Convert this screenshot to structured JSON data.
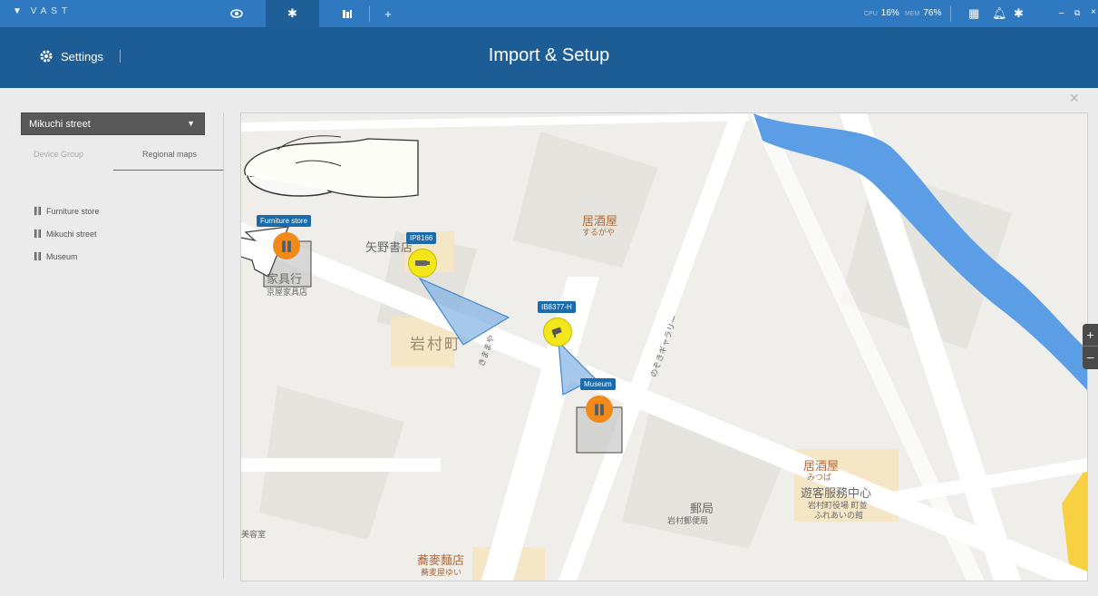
{
  "app": {
    "logo_text": "VAST"
  },
  "topbar": {
    "tabs": [
      {
        "icon": "eye-icon"
      },
      {
        "icon": "gear-icon"
      },
      {
        "icon": "floorplan-icon"
      }
    ],
    "add_tab": "+",
    "cpu_label": "CPU",
    "cpu_value": "16%",
    "mem_label": "MEM",
    "mem_value": "76%",
    "window_controls": {
      "minimize": "–",
      "restore": "⧉",
      "close": "×"
    }
  },
  "header": {
    "settings_label": "Settings",
    "title": "Import & Setup"
  },
  "sidebar": {
    "selected_map": "Mikuchi street",
    "tabs": [
      {
        "label": "Device Group"
      },
      {
        "label": "Regional maps"
      }
    ],
    "map_list": [
      {
        "label": "Furniture store"
      },
      {
        "label": "Mikuchi street"
      },
      {
        "label": "Museum"
      }
    ]
  },
  "map": {
    "markers": [
      {
        "label": "Furniture store",
        "type": "map"
      },
      {
        "label": "IP8166",
        "type": "camera"
      },
      {
        "label": "IB8377-H",
        "type": "camera"
      },
      {
        "label": "Museum",
        "type": "map"
      }
    ],
    "place_labels": {
      "kagu": "家具行",
      "kyoto_kagu": "京屋家具店",
      "yano": "矢野書店",
      "iwamura": "岩村町",
      "izakaya1": "居酒屋",
      "surugaya": "するがや",
      "izakaya2": "居酒屋",
      "mitsuba": "みつば",
      "center": "遊客服務中心",
      "yakuba": "岩村町役場 町並",
      "fureai": "ふれあいの館",
      "yubinkyoku": "郵局",
      "yubin2": "岩村郵便局",
      "soba": "蕎麥麵店",
      "soba2": "蕎麦屋ゆい",
      "biyoshitsu": "美容室",
      "kimama": "きままや",
      "nozoki": "のぞきギャラリー"
    },
    "zoom_in": "+",
    "zoom_out": "–"
  },
  "colors": {
    "topbar": "#2f79c1",
    "header": "#1d5d96",
    "accent": "#2f79c1",
    "river": "#5b9ee6",
    "marker_orange": "#f08a1a",
    "camera_yellow": "#f3e61a"
  }
}
